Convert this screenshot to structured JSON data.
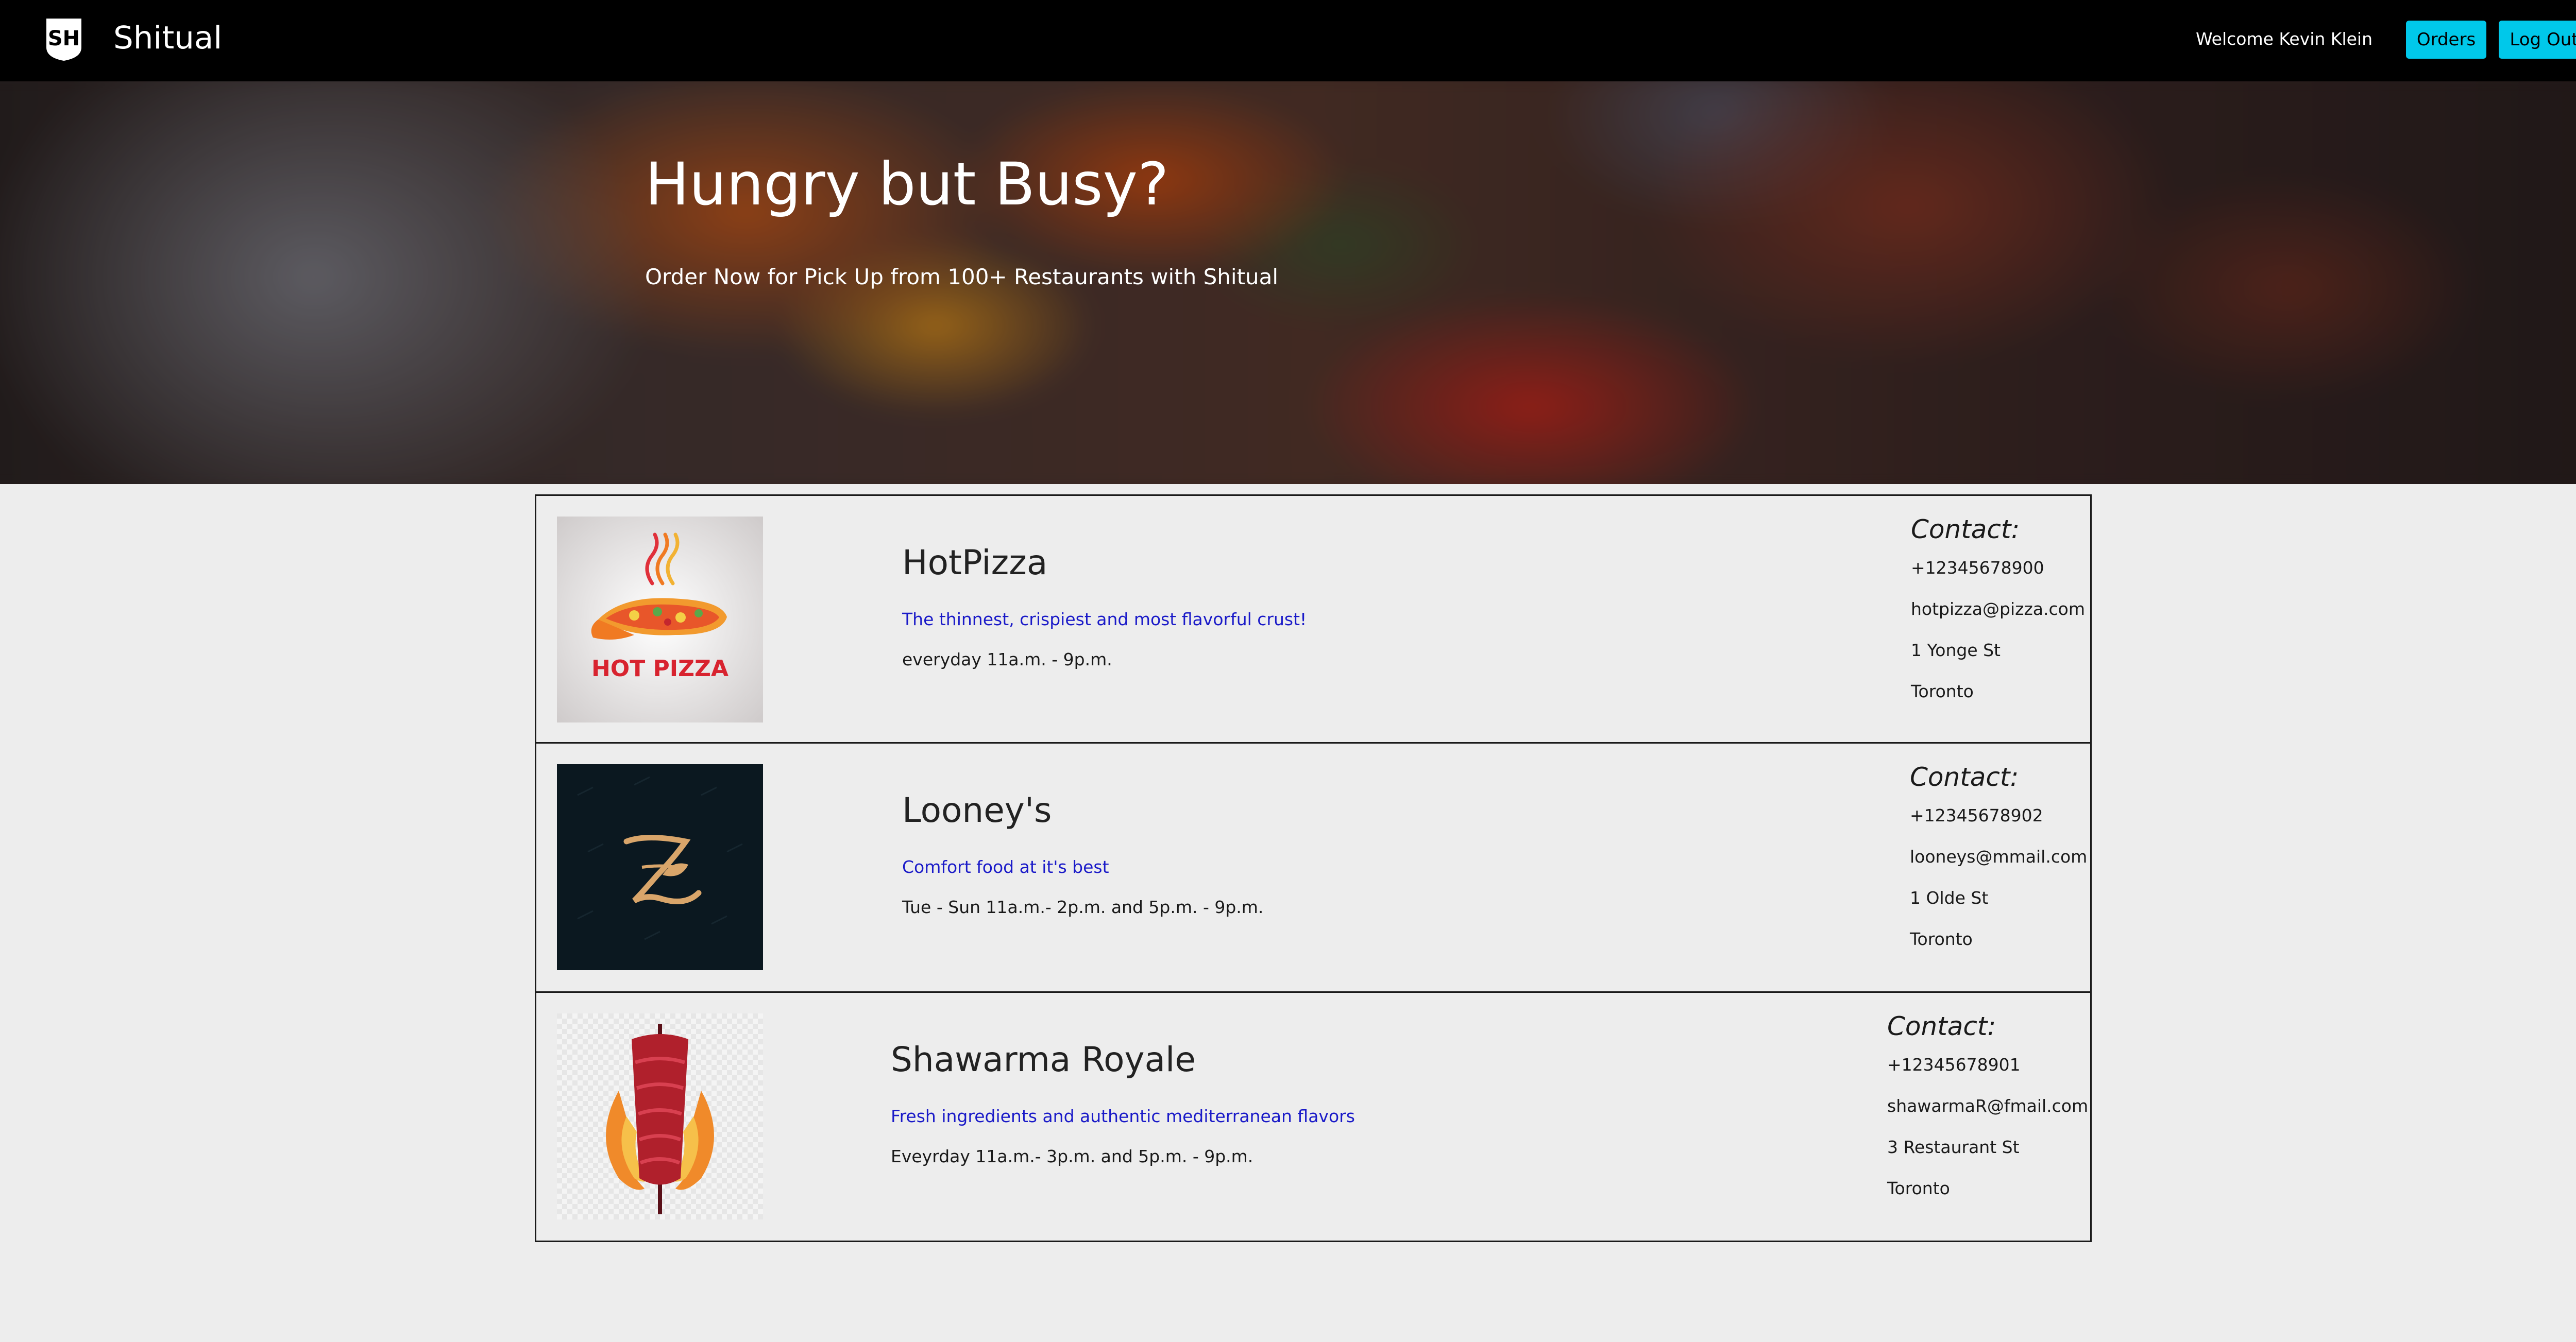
{
  "navbar": {
    "brand_initials": "SH",
    "brand_name": "Shitual",
    "welcome_text": "Welcome Kevin Klein",
    "orders_label": "Orders",
    "logout_label": "Log Out"
  },
  "hero": {
    "title": "Hungry but Busy?",
    "subtitle": "Order Now for Pick Up from 100+ Restaurants with Shitual"
  },
  "restaurants": [
    {
      "name": "HotPizza",
      "tagline": "The thinnest, crispiest and most flavorful crust!",
      "hours": "everyday 11a.m. - 9p.m.",
      "contact_title": "Contact:",
      "phone": "+12345678900",
      "email": "hotpizza@pizza.com",
      "address": "1 Yonge St",
      "city": "Toronto",
      "logo_text": "HOT PIZZA"
    },
    {
      "name": "Looney's",
      "tagline": "Comfort food at it's best",
      "hours": "Tue - Sun 11a.m.- 2p.m. and 5p.m. - 9p.m.",
      "contact_title": "Contact:",
      "phone": "+12345678902",
      "email": "looneys@mmail.com",
      "address": "1 Olde St",
      "city": "Toronto"
    },
    {
      "name": "Shawarma Royale",
      "tagline": "Fresh ingredients and authentic mediterranean flavors",
      "hours": "Eveyrday 11a.m.- 3p.m. and 5p.m. - 9p.m.",
      "contact_title": "Contact:",
      "phone": "+12345678901",
      "email": "shawarmaR@fmail.com",
      "address": "3 Restaurant St",
      "city": "Toronto"
    }
  ],
  "colors": {
    "navbar_bg": "#000000",
    "button_bg": "#00c8ea",
    "tagline": "#1a1ac8",
    "page_bg": "#ededed"
  }
}
